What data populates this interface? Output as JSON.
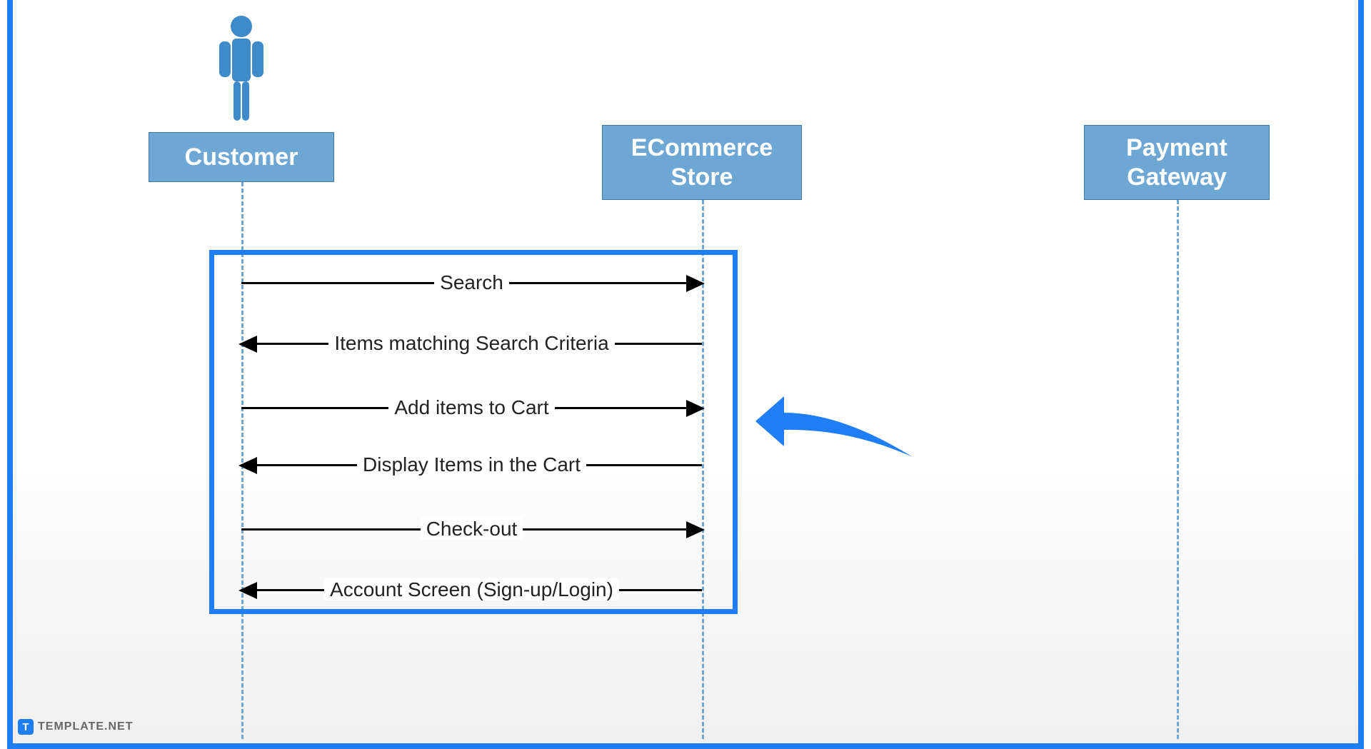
{
  "actors": {
    "customer": "Customer",
    "ecommerce_l1": "ECommerce",
    "ecommerce_l2": "Store",
    "payment_l1": "Payment",
    "payment_l2": "Gateway"
  },
  "messages": {
    "m1": "Search",
    "m2": "Items matching Search Criteria",
    "m3": "Add items to Cart",
    "m4": "Display Items in the Cart",
    "m5": "Check-out",
    "m6": "Account Screen (Sign-up/Login)"
  },
  "watermark": {
    "badge": "T",
    "text": "TEMPLATE.NET"
  },
  "colors": {
    "frame": "#1f7ef6",
    "actor_fill": "#6ea7d4"
  }
}
